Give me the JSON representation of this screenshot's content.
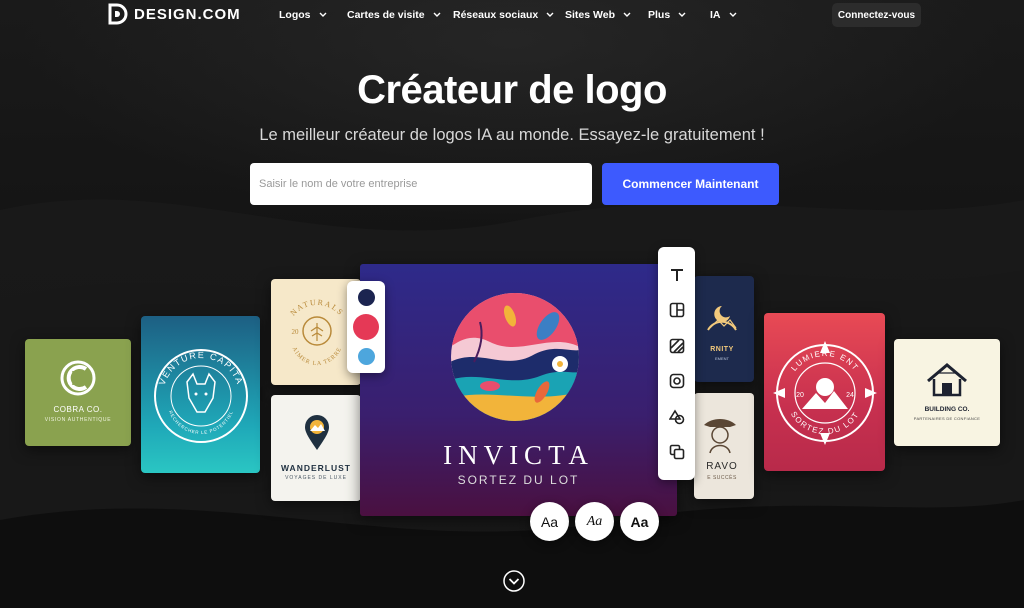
{
  "nav": {
    "brand": "DESIGN.COM",
    "items": [
      {
        "label": "Logos"
      },
      {
        "label": "Cartes de visite"
      },
      {
        "label": "Réseaux sociaux"
      },
      {
        "label": "Sites Web"
      },
      {
        "label": "Plus"
      },
      {
        "label": "IA"
      }
    ],
    "login_label": "Connectez-vous"
  },
  "hero": {
    "title": "Créateur de logo",
    "subtitle": "Le meilleur créateur de logos IA au monde. Essayez-le gratuitement !",
    "input_placeholder": "Saisir le nom de votre entreprise",
    "input_value": "",
    "cta_label": "Commencer Maintenant"
  },
  "showcase": {
    "cobra": {
      "name": "COBRA CO.",
      "tagline": "VISION AUTHENTIQUE"
    },
    "venture": {
      "arc_top": "VENTURE CAPITA",
      "arc_bottom": "RECHERCHER LE POTENTIEL"
    },
    "naturals": {
      "arc": "NATURALS",
      "arc_bottom": "AIMER LA TERRE",
      "num": "20"
    },
    "wanderlust": {
      "name": "WANDERLUST",
      "tagline": "VOYAGES DE LUXE"
    },
    "main": {
      "name": "INVICTA",
      "tagline": "SORTEZ DU LOT"
    },
    "ternity": {
      "name": "RNITY",
      "tagline": "EMENT"
    },
    "bravo": {
      "name": "RAVO",
      "tagline": "E SUCCÈS"
    },
    "lumiere": {
      "arc_top": "LUMIERE ENT",
      "arc_bottom": "SORTEZ DU LOT",
      "num_left": "20",
      "num_right": "24"
    },
    "building": {
      "name": "BUILDING CO.",
      "tagline": "PARTENAIRES DE CONFIANCE"
    }
  },
  "palette": {
    "colors": [
      "#1b2450",
      "#e53956",
      "#4da6dd"
    ]
  },
  "toolbar": {
    "tools": [
      "text-icon",
      "layout-icon",
      "pattern-icon",
      "frame-icon",
      "shapes-icon",
      "layers-icon"
    ]
  },
  "fonts": {
    "options": [
      "Aa",
      "Aa",
      "Aa"
    ]
  },
  "colors": {
    "accent": "#3d5afe",
    "background": "#141414"
  }
}
